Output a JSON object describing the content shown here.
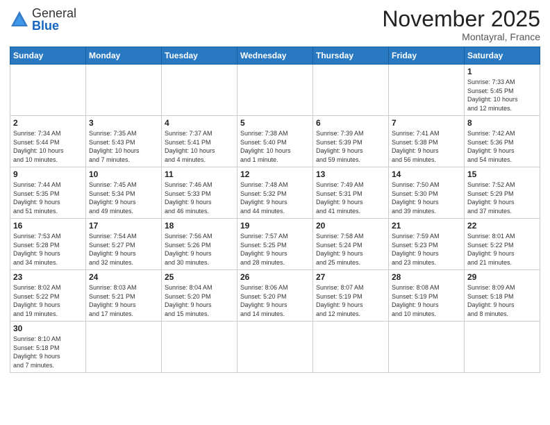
{
  "header": {
    "logo_general": "General",
    "logo_blue": "Blue",
    "month_title": "November 2025",
    "location": "Montayral, France"
  },
  "weekdays": [
    "Sunday",
    "Monday",
    "Tuesday",
    "Wednesday",
    "Thursday",
    "Friday",
    "Saturday"
  ],
  "weeks": [
    [
      {
        "day": "",
        "info": ""
      },
      {
        "day": "",
        "info": ""
      },
      {
        "day": "",
        "info": ""
      },
      {
        "day": "",
        "info": ""
      },
      {
        "day": "",
        "info": ""
      },
      {
        "day": "",
        "info": ""
      },
      {
        "day": "1",
        "info": "Sunrise: 7:33 AM\nSunset: 5:45 PM\nDaylight: 10 hours\nand 12 minutes."
      }
    ],
    [
      {
        "day": "2",
        "info": "Sunrise: 7:34 AM\nSunset: 5:44 PM\nDaylight: 10 hours\nand 10 minutes."
      },
      {
        "day": "3",
        "info": "Sunrise: 7:35 AM\nSunset: 5:43 PM\nDaylight: 10 hours\nand 7 minutes."
      },
      {
        "day": "4",
        "info": "Sunrise: 7:37 AM\nSunset: 5:41 PM\nDaylight: 10 hours\nand 4 minutes."
      },
      {
        "day": "5",
        "info": "Sunrise: 7:38 AM\nSunset: 5:40 PM\nDaylight: 10 hours\nand 1 minute."
      },
      {
        "day": "6",
        "info": "Sunrise: 7:39 AM\nSunset: 5:39 PM\nDaylight: 9 hours\nand 59 minutes."
      },
      {
        "day": "7",
        "info": "Sunrise: 7:41 AM\nSunset: 5:38 PM\nDaylight: 9 hours\nand 56 minutes."
      },
      {
        "day": "8",
        "info": "Sunrise: 7:42 AM\nSunset: 5:36 PM\nDaylight: 9 hours\nand 54 minutes."
      }
    ],
    [
      {
        "day": "9",
        "info": "Sunrise: 7:44 AM\nSunset: 5:35 PM\nDaylight: 9 hours\nand 51 minutes."
      },
      {
        "day": "10",
        "info": "Sunrise: 7:45 AM\nSunset: 5:34 PM\nDaylight: 9 hours\nand 49 minutes."
      },
      {
        "day": "11",
        "info": "Sunrise: 7:46 AM\nSunset: 5:33 PM\nDaylight: 9 hours\nand 46 minutes."
      },
      {
        "day": "12",
        "info": "Sunrise: 7:48 AM\nSunset: 5:32 PM\nDaylight: 9 hours\nand 44 minutes."
      },
      {
        "day": "13",
        "info": "Sunrise: 7:49 AM\nSunset: 5:31 PM\nDaylight: 9 hours\nand 41 minutes."
      },
      {
        "day": "14",
        "info": "Sunrise: 7:50 AM\nSunset: 5:30 PM\nDaylight: 9 hours\nand 39 minutes."
      },
      {
        "day": "15",
        "info": "Sunrise: 7:52 AM\nSunset: 5:29 PM\nDaylight: 9 hours\nand 37 minutes."
      }
    ],
    [
      {
        "day": "16",
        "info": "Sunrise: 7:53 AM\nSunset: 5:28 PM\nDaylight: 9 hours\nand 34 minutes."
      },
      {
        "day": "17",
        "info": "Sunrise: 7:54 AM\nSunset: 5:27 PM\nDaylight: 9 hours\nand 32 minutes."
      },
      {
        "day": "18",
        "info": "Sunrise: 7:56 AM\nSunset: 5:26 PM\nDaylight: 9 hours\nand 30 minutes."
      },
      {
        "day": "19",
        "info": "Sunrise: 7:57 AM\nSunset: 5:25 PM\nDaylight: 9 hours\nand 28 minutes."
      },
      {
        "day": "20",
        "info": "Sunrise: 7:58 AM\nSunset: 5:24 PM\nDaylight: 9 hours\nand 25 minutes."
      },
      {
        "day": "21",
        "info": "Sunrise: 7:59 AM\nSunset: 5:23 PM\nDaylight: 9 hours\nand 23 minutes."
      },
      {
        "day": "22",
        "info": "Sunrise: 8:01 AM\nSunset: 5:22 PM\nDaylight: 9 hours\nand 21 minutes."
      }
    ],
    [
      {
        "day": "23",
        "info": "Sunrise: 8:02 AM\nSunset: 5:22 PM\nDaylight: 9 hours\nand 19 minutes."
      },
      {
        "day": "24",
        "info": "Sunrise: 8:03 AM\nSunset: 5:21 PM\nDaylight: 9 hours\nand 17 minutes."
      },
      {
        "day": "25",
        "info": "Sunrise: 8:04 AM\nSunset: 5:20 PM\nDaylight: 9 hours\nand 15 minutes."
      },
      {
        "day": "26",
        "info": "Sunrise: 8:06 AM\nSunset: 5:20 PM\nDaylight: 9 hours\nand 14 minutes."
      },
      {
        "day": "27",
        "info": "Sunrise: 8:07 AM\nSunset: 5:19 PM\nDaylight: 9 hours\nand 12 minutes."
      },
      {
        "day": "28",
        "info": "Sunrise: 8:08 AM\nSunset: 5:19 PM\nDaylight: 9 hours\nand 10 minutes."
      },
      {
        "day": "29",
        "info": "Sunrise: 8:09 AM\nSunset: 5:18 PM\nDaylight: 9 hours\nand 8 minutes."
      }
    ],
    [
      {
        "day": "30",
        "info": "Sunrise: 8:10 AM\nSunset: 5:18 PM\nDaylight: 9 hours\nand 7 minutes."
      },
      {
        "day": "",
        "info": ""
      },
      {
        "day": "",
        "info": ""
      },
      {
        "day": "",
        "info": ""
      },
      {
        "day": "",
        "info": ""
      },
      {
        "day": "",
        "info": ""
      },
      {
        "day": "",
        "info": ""
      }
    ]
  ]
}
